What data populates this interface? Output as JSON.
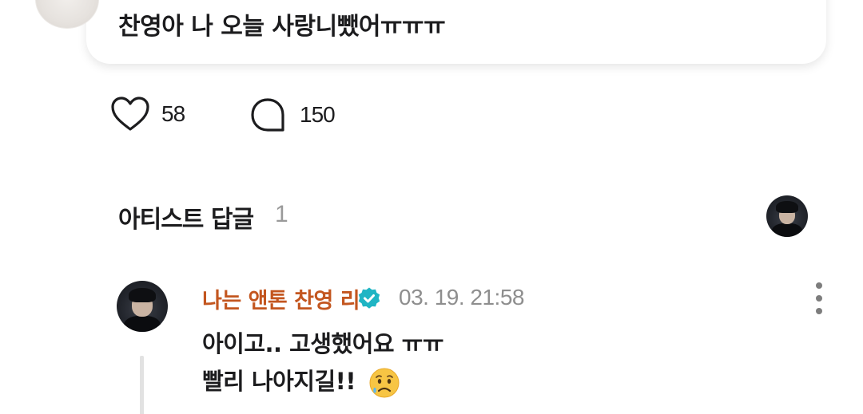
{
  "post": {
    "text": "찬영아 나 오늘 사랑니뺐어ㅠㅠㅠ"
  },
  "reactions": {
    "likes": "58",
    "comments": "150"
  },
  "artist_replies": {
    "title": "아티스트 답글",
    "count": "1"
  },
  "reply": {
    "author": "나는 앤톤 찬영 리",
    "timestamp": "03. 19. 21:58",
    "line1": "아이고.. 고생했어요 ㅠㅠ",
    "line2": "빨리 나아지길!!"
  },
  "colors": {
    "author": "#c3561f",
    "verified": "#1fb5c4",
    "timestamp": "#8e8e8e",
    "count_muted": "#9a9a9a"
  },
  "icons": [
    "heart-icon",
    "comment-bubble-icon",
    "verified-badge-icon",
    "more-vertical-icon",
    "worried-face-emoji"
  ]
}
